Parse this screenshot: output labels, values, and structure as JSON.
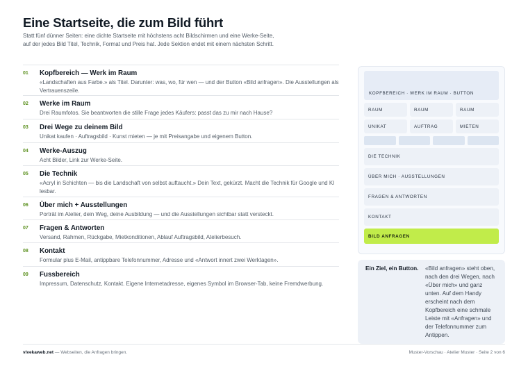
{
  "page": {
    "title": "Eine Startseite, die zum Bild führt",
    "intro": "Statt fünf dünner Seiten: eine dichte Startseite mit höchstens acht Bildschirmen und eine Werke-Seite, auf der jedes Bild Titel, Technik, Format und Preis hat. Jede Sektion endet mit einem nächsten Schritt."
  },
  "sections": [
    {
      "num": "01",
      "title": "Kopfbereich — Werk im Raum",
      "desc": "«Landschaften aus Farbe.» als Titel. Darunter: was, wo, für wen — und der Button «Bild anfragen». Die Ausstellungen als Vertrauenszeile."
    },
    {
      "num": "02",
      "title": "Werke im Raum",
      "desc": "Drei Raumfotos. Sie beantworten die stille Frage jedes Käufers: passt das zu mir nach Hause?"
    },
    {
      "num": "03",
      "title": "Drei Wege zu deinem Bild",
      "desc": "Unikat kaufen · Auftragsbild · Kunst mieten — je mit Preisangabe und eigenem Button."
    },
    {
      "num": "04",
      "title": "Werke-Auszug",
      "desc": "Acht Bilder, Link zur Werke-Seite."
    },
    {
      "num": "05",
      "title": "Die Technik",
      "desc": "«Acryl in Schichten — bis die Landschaft von selbst auftaucht.» Dein Text, gekürzt. Macht die Technik für Google und KI lesbar."
    },
    {
      "num": "06",
      "title": "Über mich + Ausstellungen",
      "desc": "Porträt im Atelier, dein Weg, deine Ausbildung — und die Ausstellungen sichtbar statt versteckt."
    },
    {
      "num": "07",
      "title": "Fragen & Antworten",
      "desc": "Versand, Rahmen, Rückgabe, Mietkonditionen, Ablauf Auftragsbild, Atelierbesuch."
    },
    {
      "num": "08",
      "title": "Kontakt",
      "desc": "Formular plus E-Mail, antippbare Telefonnummer, Adresse und «Antwort innert zwei Werktagen»."
    },
    {
      "num": "09",
      "title": "Fussbereich",
      "desc": "Impressum, Datenschutz, Kontakt. Eigene Internetadresse, eigenes Symbol im Browser-Tab, keine Fremdwerbung."
    }
  ],
  "mockup": {
    "hero": "KOPFBEREICH · WERK IM RAUM · BUTTON",
    "row1": [
      "RAUM",
      "RAUM",
      "RAUM"
    ],
    "row2": [
      "UNIKAT",
      "AUFTRAG",
      "MIETEN"
    ],
    "technik": "DIE TECHNIK",
    "ueber": "ÜBER MICH · AUSSTELLUNGEN",
    "faq": "FRAGEN & ANTWORTEN",
    "kontakt": "KONTAKT",
    "cta": "BILD ANFRAGEN",
    "cta_color": "#c1ec4a"
  },
  "note": {
    "title": "Ein Ziel, ein Button.",
    "text": "«Bild anfragen» steht oben, nach den drei Wegen, nach «Über mich» und ganz unten. Auf dem Handy erscheint nach dem Kopfbereich eine schmale Leiste mit «Anfragen» und der Telefonnummer zum Antippen."
  },
  "footer": {
    "brand": "vivekaweb.net",
    "tagline": " — Webseiten, die Anfragen bringen.",
    "right": "Muster-Vorschau · Atelier Muster · Seite 2 von 6"
  }
}
